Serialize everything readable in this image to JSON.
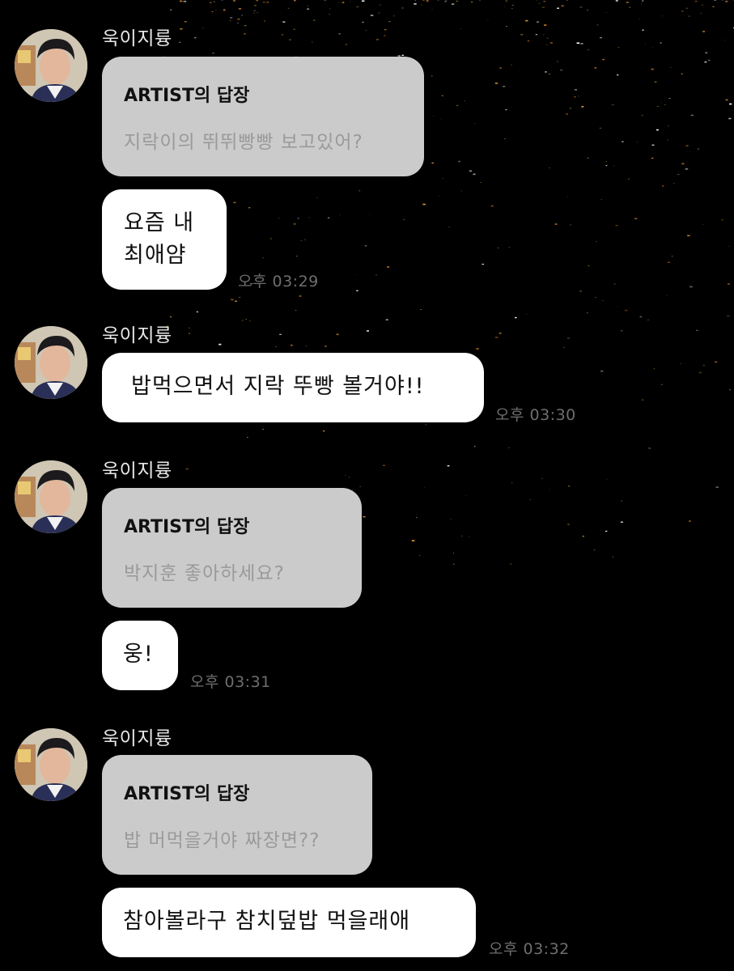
{
  "sender_name": "욱이지륭",
  "reply_label": "ARTIST의 답장",
  "messages": [
    {
      "reply_text": "지락이의 뛰뛰빵빵 보고있어?",
      "reply_lines": [
        "요즘 내",
        "최애얌"
      ],
      "time": "오후 03:29"
    },
    {
      "reply_lines": [
        "밥먹으면서 지락 뚜빵 볼거야!!"
      ],
      "time": "오후 03:30"
    },
    {
      "reply_text": "박지훈 좋아하세요?",
      "reply_lines": [
        "웅!"
      ],
      "time": "오후 03:31"
    },
    {
      "reply_text": "밥 머먹을거야 짜장면??",
      "reply_lines": [
        "참아볼라구 참치덮밥 먹을래애"
      ],
      "time": "오후 03:32"
    }
  ],
  "colors": {
    "background": "#000000",
    "reply_card": "#cbcbcb",
    "bubble": "#ffffff",
    "time_text": "#6e6e6e"
  },
  "icons": {
    "avatar": "profile-photo"
  }
}
